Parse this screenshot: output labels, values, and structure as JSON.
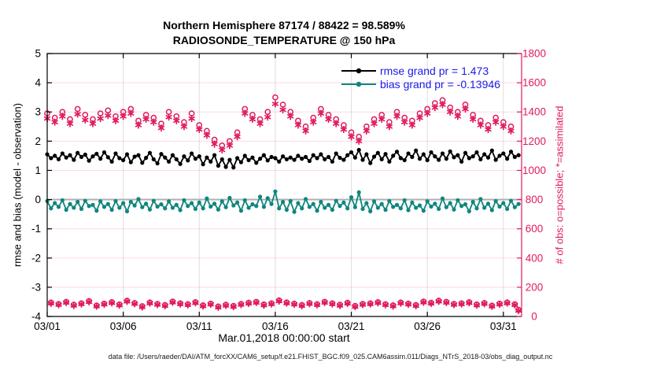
{
  "title": {
    "line1": "Northern Hemisphere 87174 / 88422 = 98.589%",
    "line2": "RADIOSONDE_TEMPERATURE @ 150 hPa"
  },
  "legend": [
    {
      "label": "rmse grand pr = 1.473",
      "series_color": "#000000"
    },
    {
      "label": "bias grand pr = -0.13946",
      "series_color": "#0e867e"
    }
  ],
  "footer": {
    "data_file": "data file: /Users/raeder/DAI/ATM_forcXX/CAM6_setup/f.e21.FHIST_BGC.f09_025.CAM6assim.011/Diags_NTrS_2018-03/obs_diag_output.nc"
  },
  "colors": {
    "counts_pink": "#e01a5c",
    "bias_teal": "#0e867e",
    "rmse_black": "#000000",
    "legend_text_blue": "#1a1aee",
    "zero_line_gray": "#b0b0b0",
    "h_grid": "rgba(224,26,92,0.16)",
    "v_grid": "rgba(150,130,140,0.28)"
  },
  "chart_data": {
    "type": "line",
    "title": "Northern Hemisphere 87174 / 88422 = 98.589% | RADIOSONDE_TEMPERATURE @ 150 hPa",
    "x_axis": {
      "label": "Mar.01,2018 00:00:00 start",
      "lim": [
        1,
        32.2
      ],
      "tick_days": [
        1,
        6,
        11,
        16,
        21,
        26,
        31
      ],
      "tick_labels": [
        "03/01",
        "03/06",
        "03/11",
        "03/16",
        "03/21",
        "03/26",
        "03/31"
      ]
    },
    "left_axis": {
      "label": "rmse and bias (model - observation)",
      "lim": [
        -4,
        5
      ],
      "ticks": [
        -4,
        -3,
        -2,
        -1,
        0,
        1,
        2,
        3,
        4,
        5
      ],
      "zero_line": 0
    },
    "right_axis": {
      "label": "# of obs: o=possible; *=assimilated",
      "lim": [
        0,
        1800
      ],
      "ticks": [
        0,
        200,
        400,
        600,
        800,
        1000,
        1200,
        1400,
        1600,
        1800
      ]
    },
    "x_start_day": 1,
    "x_step_days": 0.25,
    "n_points": 125,
    "grid": true,
    "legend_position": "top-right-inside",
    "series": [
      {
        "name": "rmse",
        "axis": "left",
        "marker": "filled-circle",
        "line": true,
        "color": "#000000",
        "grand": 1.473,
        "values": [
          1.55,
          1.42,
          1.5,
          1.38,
          1.58,
          1.44,
          1.52,
          1.36,
          1.6,
          1.46,
          1.54,
          1.33,
          1.48,
          1.57,
          1.4,
          1.62,
          1.45,
          1.3,
          1.58,
          1.42,
          1.35,
          1.55,
          1.28,
          1.47,
          1.52,
          1.26,
          1.43,
          1.6,
          1.38,
          1.24,
          1.56,
          1.44,
          1.3,
          1.52,
          1.38,
          1.22,
          1.48,
          1.34,
          1.58,
          1.4,
          1.48,
          1.21,
          1.44,
          1.3,
          1.52,
          1.16,
          1.38,
          1.12,
          1.36,
          1.1,
          1.42,
          1.28,
          1.5,
          1.35,
          1.44,
          1.26,
          1.4,
          1.52,
          1.34,
          1.46,
          1.42,
          1.3,
          1.48,
          1.38,
          1.44,
          1.36,
          1.5,
          1.4,
          1.46,
          1.32,
          1.52,
          1.42,
          1.55,
          1.38,
          1.46,
          1.3,
          1.58,
          1.43,
          1.36,
          1.52,
          1.62,
          1.44,
          1.7,
          1.36,
          1.55,
          1.25,
          1.47,
          1.6,
          1.38,
          1.56,
          1.3,
          1.5,
          1.64,
          1.42,
          1.35,
          1.58,
          1.46,
          1.68,
          1.4,
          1.55,
          1.35,
          1.62,
          1.48,
          1.36,
          1.58,
          1.4,
          1.65,
          1.45,
          1.52,
          1.3,
          1.6,
          1.42,
          1.48,
          1.62,
          1.38,
          1.55,
          1.44,
          1.68,
          1.36,
          1.5,
          1.58,
          1.4,
          1.64,
          1.46,
          1.52
        ]
      },
      {
        "name": "bias",
        "axis": "left",
        "marker": "filled-circle",
        "line": true,
        "color": "#0e867e",
        "grand": -0.13946,
        "values": [
          -0.05,
          -0.3,
          -0.12,
          -0.25,
          -0.02,
          -0.35,
          -0.15,
          -0.28,
          -0.08,
          -0.32,
          -0.04,
          -0.22,
          -0.18,
          -0.38,
          -0.06,
          -0.25,
          -0.15,
          -0.35,
          -0.05,
          -0.28,
          -0.12,
          -0.4,
          -0.08,
          -0.2,
          0.02,
          -0.26,
          -0.14,
          -0.34,
          -0.04,
          -0.24,
          -0.16,
          -0.3,
          -0.06,
          -0.28,
          -0.18,
          -0.36,
          -0.02,
          -0.22,
          -0.12,
          -0.32,
          -0.1,
          -0.3,
          0.04,
          -0.24,
          -0.14,
          -0.34,
          -0.06,
          -0.26,
          0.06,
          -0.2,
          -0.1,
          -0.38,
          -0.02,
          -0.28,
          -0.16,
          -0.22,
          0.1,
          -0.25,
          0.05,
          -0.15,
          0.28,
          -0.3,
          -0.08,
          -0.35,
          -0.05,
          -0.42,
          -0.12,
          -0.3,
          0.02,
          -0.25,
          -0.15,
          -0.38,
          -0.08,
          -0.28,
          -0.18,
          -0.35,
          -0.04,
          -0.22,
          -0.1,
          -0.3,
          0.08,
          -0.26,
          0.25,
          -0.32,
          -0.12,
          -0.4,
          -0.06,
          -0.28,
          -0.15,
          -0.35,
          -0.05,
          -0.25,
          -0.18,
          -0.3,
          -0.02,
          -0.36,
          -0.1,
          -0.28,
          -0.2,
          -0.38,
          -0.06,
          -0.24,
          -0.14,
          -0.32,
          0.04,
          -0.26,
          -0.12,
          -0.34,
          -0.02,
          -0.22,
          -0.16,
          -0.4,
          -0.08,
          -0.3,
          0.02,
          -0.28,
          -0.14,
          -0.36,
          -0.05,
          -0.24,
          -0.12,
          -0.32,
          -0.04,
          -0.26,
          -0.15
        ]
      },
      {
        "name": "N_possible",
        "axis": "right",
        "marker": "open-circle",
        "line": false,
        "color": "#e01a5c",
        "values": [
          1390,
          95,
          1360,
          85,
          1400,
          100,
          1350,
          80,
          1420,
          90,
          1380,
          105,
          1350,
          75,
          1390,
          88,
          1410,
          98,
          1370,
          82,
          1400,
          108,
          1420,
          92,
          1340,
          70,
          1380,
          96,
          1360,
          86,
          1320,
          78,
          1400,
          102,
          1370,
          90,
          1330,
          84,
          1390,
          98,
          1310,
          76,
          1270,
          88,
          1210,
          68,
          1170,
          80,
          1200,
          72,
          1260,
          86,
          1420,
          94,
          1380,
          100,
          1350,
          82,
          1400,
          90,
          1500,
          110,
          1450,
          96,
          1400,
          88,
          1340,
          78,
          1300,
          92,
          1360,
          84,
          1420,
          100,
          1380,
          90,
          1350,
          80,
          1310,
          94,
          1260,
          72,
          1230,
          86,
          1300,
          90,
          1350,
          98,
          1380,
          84,
          1330,
          76,
          1400,
          96,
          1360,
          88,
          1340,
          78,
          1390,
          102,
          1420,
          94,
          1460,
          108,
          1480,
          100,
          1430,
          86,
          1400,
          90,
          1450,
          98,
          1380,
          82,
          1340,
          92,
          1310,
          74,
          1360,
          88,
          1330,
          96,
          1300,
          84,
          45
        ]
      },
      {
        "name": "N_assimilated",
        "axis": "right",
        "marker": "asterisk",
        "line": false,
        "color": "#e01a5c",
        "values": [
          1355,
          90,
          1330,
          80,
          1370,
          95,
          1320,
          75,
          1385,
          85,
          1345,
          100,
          1320,
          70,
          1355,
          83,
          1375,
          93,
          1340,
          77,
          1370,
          103,
          1390,
          87,
          1310,
          65,
          1350,
          91,
          1330,
          81,
          1290,
          73,
          1365,
          97,
          1340,
          85,
          1300,
          79,
          1355,
          93,
          1280,
          71,
          1240,
          83,
          1180,
          63,
          1140,
          75,
          1170,
          67,
          1230,
          81,
          1390,
          89,
          1350,
          95,
          1320,
          77,
          1365,
          85,
          1455,
          105,
          1415,
          91,
          1370,
          83,
          1310,
          73,
          1270,
          87,
          1330,
          79,
          1390,
          95,
          1350,
          85,
          1320,
          75,
          1280,
          89,
          1230,
          67,
          1200,
          81,
          1270,
          85,
          1320,
          93,
          1350,
          79,
          1300,
          71,
          1370,
          91,
          1330,
          83,
          1310,
          73,
          1360,
          97,
          1390,
          89,
          1430,
          103,
          1450,
          95,
          1400,
          81,
          1370,
          85,
          1420,
          93,
          1350,
          77,
          1310,
          87,
          1280,
          69,
          1330,
          83,
          1300,
          91,
          1270,
          79,
          40
        ]
      }
    ]
  }
}
